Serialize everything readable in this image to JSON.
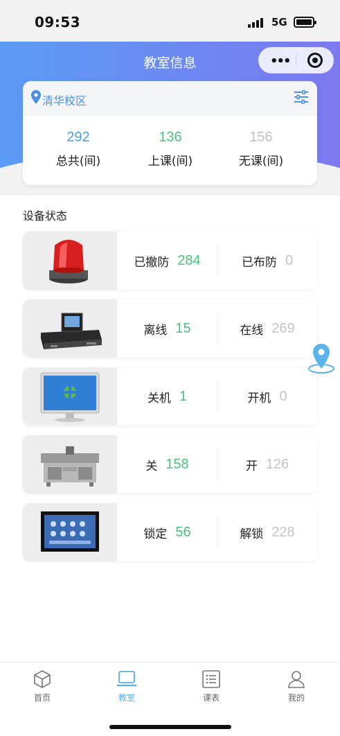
{
  "status_bar": {
    "time": "09:53",
    "network": "5G"
  },
  "header": {
    "title": "教室信息",
    "menu_icon": "more-dots-icon",
    "close_icon": "target-circle-icon"
  },
  "summary": {
    "campus": "清华校区",
    "stats": [
      {
        "value": "292",
        "label": "总共(间)",
        "color": "#4a9fe0"
      },
      {
        "value": "136",
        "label": "上课(间)",
        "color": "#4cc17e"
      },
      {
        "value": "156",
        "label": "无课(间)",
        "color": "#bfbfbf"
      }
    ]
  },
  "section_title": "设备状态",
  "devices": [
    {
      "icon": "alarm-light-icon",
      "a_label": "已撤防",
      "a_value": "284",
      "b_label": "已布防",
      "b_value": "0"
    },
    {
      "icon": "control-host-icon",
      "a_label": "离线",
      "a_value": "15",
      "b_label": "在线",
      "b_value": "269"
    },
    {
      "icon": "monitor-icon",
      "a_label": "关机",
      "a_value": "1",
      "b_label": "开机",
      "b_value": "0"
    },
    {
      "icon": "podium-icon",
      "a_label": "关",
      "a_value": "158",
      "b_label": "开",
      "b_value": "126"
    },
    {
      "icon": "touch-panel-icon",
      "a_label": "锁定",
      "a_value": "56",
      "b_label": "解锁",
      "b_value": "228"
    }
  ],
  "tabs": [
    {
      "label": "首页",
      "icon": "cube-icon",
      "active": false
    },
    {
      "label": "教室",
      "icon": "laptop-icon",
      "active": true
    },
    {
      "label": "课表",
      "icon": "list-icon",
      "active": false
    },
    {
      "label": "我的",
      "icon": "user-icon",
      "active": false
    }
  ],
  "colors": {
    "accent_blue": "#4a90e2",
    "green": "#4cc17e",
    "gray": "#c4c4c4",
    "tab_active": "#5aaee8"
  }
}
